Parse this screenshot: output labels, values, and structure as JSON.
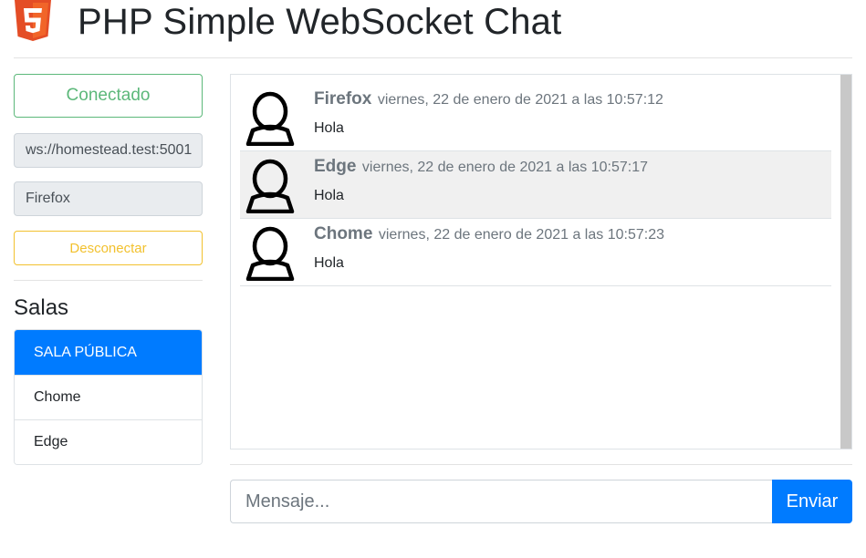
{
  "header": {
    "title": "PHP Simple WebSocket Chat",
    "logo_icon": "html5-logo-icon",
    "logo_text": "5"
  },
  "sidebar": {
    "status": "Conectado",
    "server_url": "ws://homestead.test:5001",
    "username": "Firefox",
    "disconnect_label": "Desconectar",
    "rooms_heading": "Salas",
    "rooms": [
      {
        "label": "SALA PÚBLICA",
        "active": true
      },
      {
        "label": "Chome",
        "active": false
      },
      {
        "label": "Edge",
        "active": false
      }
    ]
  },
  "chat": {
    "messages": [
      {
        "author": "Firefox",
        "time": "viernes, 22 de enero de 2021 a las 10:57:12",
        "text": "Hola",
        "avatar_icon": "user-avatar-icon"
      },
      {
        "author": "Edge",
        "time": "viernes, 22 de enero de 2021 a las 10:57:17",
        "text": "Hola",
        "avatar_icon": "user-avatar-icon"
      },
      {
        "author": "Chome",
        "time": "viernes, 22 de enero de 2021 a las 10:57:23",
        "text": "Hola",
        "avatar_icon": "user-avatar-icon"
      }
    ]
  },
  "composer": {
    "placeholder": "Mensaje...",
    "send_label": "Enviar"
  },
  "colors": {
    "primary": "#007bff",
    "success": "#5cb87a",
    "warning": "#f2c12e",
    "html5_orange": "#e44d26"
  }
}
